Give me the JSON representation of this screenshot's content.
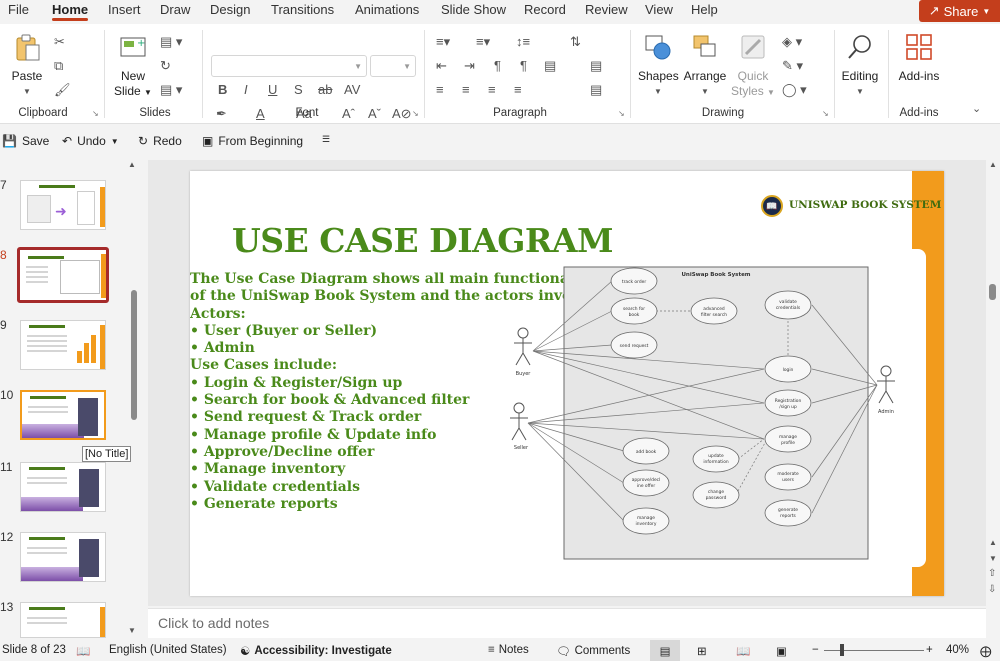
{
  "menu": {
    "tabs": [
      "File",
      "Home",
      "Insert",
      "Draw",
      "Design",
      "Transitions",
      "Animations",
      "Slide Show",
      "Record",
      "Review",
      "View",
      "Help"
    ],
    "active": "Home",
    "share_label": "Share"
  },
  "ribbon": {
    "clipboard": {
      "paste_label": "Paste",
      "group_label": "Clipboard"
    },
    "slides": {
      "new_slide_label_1": "New",
      "new_slide_label_2": "Slide",
      "group_label": "Slides"
    },
    "font": {
      "group_label": "Font",
      "font_name": "",
      "font_size": ""
    },
    "paragraph": {
      "group_label": "Paragraph"
    },
    "drawing": {
      "shapes_label": "Shapes",
      "arrange_label": "Arrange",
      "quick_styles_label_1": "Quick",
      "quick_styles_label_2": "Styles",
      "group_label": "Drawing"
    },
    "editing": {
      "label": "Editing"
    },
    "addins": {
      "label": "Add-ins",
      "group_label": "Add-ins"
    }
  },
  "qat": {
    "save_label": "Save",
    "undo_label": "Undo",
    "redo_label": "Redo",
    "from_beginning_label": "From Beginning"
  },
  "thumbnails": {
    "numbers": [
      "7",
      "8",
      "9",
      "10",
      "11",
      "12",
      "13"
    ],
    "selected": "8",
    "tooltip": "[No Title]"
  },
  "slide": {
    "brand": "UNISWAP BOOK SYSTEM",
    "title": "USE CASE DIAGRAM",
    "lines": [
      "The Use Case Diagram shows all main functionalities",
      "of the UniSwap Book System and the actors involved.",
      "Actors:",
      "• User (Buyer or Seller)",
      "• Admin",
      "Use Cases include:",
      "• Login & Register/Sign up",
      "• Search for book & Advanced filter",
      "• Send request & Track order",
      "• Manage profile & Update info",
      "• Approve/Decline offer",
      "• Manage inventory",
      "• Validate credentials",
      "• Generate reports"
    ],
    "diagram": {
      "system_title": "UniSwap Book System",
      "actors": {
        "buyer": "Buyer",
        "seller": "Seller",
        "admin": "Admin"
      },
      "use_cases": {
        "track_order": "track order",
        "search_book_1": "search for",
        "search_book_2": "book",
        "advanced_filter_1": "advanced",
        "advanced_filter_2": "filter search",
        "send_request": "send request",
        "validate_1": "validate",
        "validate_2": "credentials",
        "login": "login",
        "register_1": "Registration",
        "register_2": "/sign up",
        "manage_profile_1": "manage",
        "manage_profile_2": "profile",
        "add_book": "add book",
        "update_info_1": "update",
        "update_info_2": "information",
        "approve_1": "approve/decl",
        "approve_2": "ine offer",
        "moderate_1": "moderate",
        "moderate_2": "users",
        "change_pw_1": "change",
        "change_pw_2": "password",
        "generate_1": "generate",
        "generate_2": "reports",
        "manage_inv_1": "manage",
        "manage_inv_2": "inventory"
      }
    }
  },
  "notes_placeholder": "Click to add notes",
  "status": {
    "slide_counter": "Slide 8 of 23",
    "language": "English (United States)",
    "accessibility": "Accessibility: Investigate",
    "notes_label": "Notes",
    "comments_label": "Comments",
    "zoom": "40%"
  },
  "colors": {
    "accent": "#c43e1c",
    "title_green": "#4a8a1a",
    "orange": "#f29b1c"
  }
}
